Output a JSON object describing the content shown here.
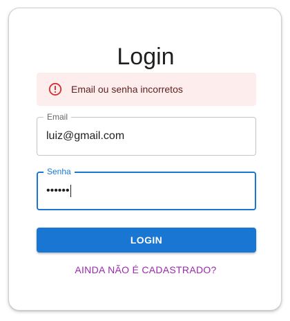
{
  "title": "Login",
  "alert": {
    "message": "Email ou senha incorretos",
    "icon": "error-outline-icon",
    "background": "#fdeded",
    "icon_color": "#d32f2f"
  },
  "email_field": {
    "label": "Email",
    "value": "luiz@gmail.com"
  },
  "password_field": {
    "label": "Senha",
    "masked_value": "••••••",
    "focus_color": "#1976d2"
  },
  "login_button": {
    "label": "LOGIN",
    "color": "#1976d2"
  },
  "register_link": {
    "label": "AINDA NÃO É CADASTRADO?",
    "color": "#9c27b0"
  }
}
